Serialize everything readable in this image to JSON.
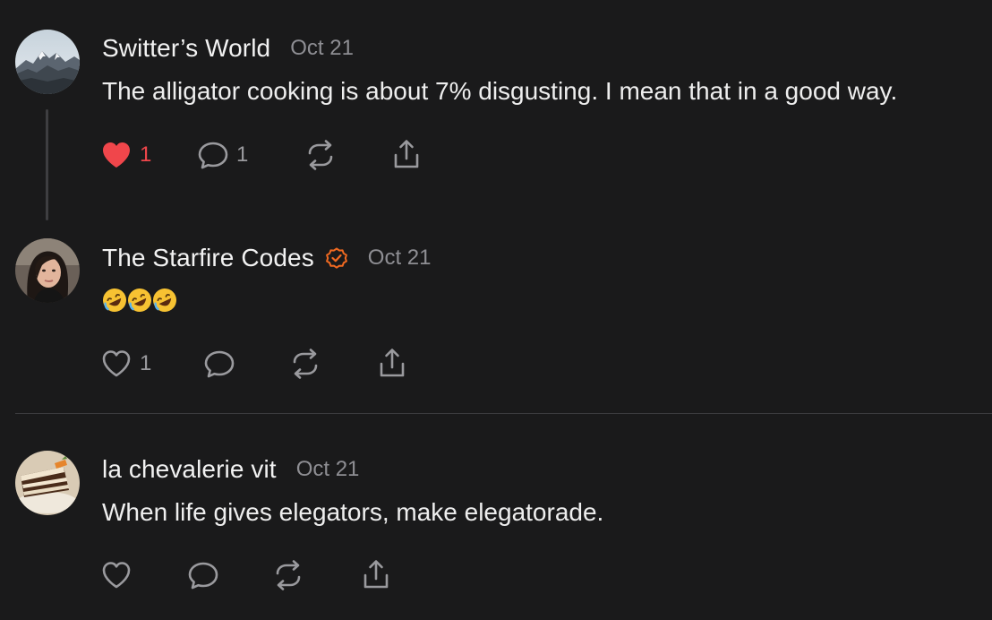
{
  "posts": [
    {
      "author": "Switter’s World",
      "date": "Oct 21",
      "text": "The alligator cooking is about 7% disgusting. I mean that in a good way.",
      "likes": "1",
      "liked": true,
      "comments": "1",
      "avatar": "mountain-landscape"
    },
    {
      "author": "The Starfire Codes",
      "verified": true,
      "date": "Oct 21",
      "emoji": "rolling-on-floor-laughing x3",
      "likes": "1",
      "liked": false,
      "comments": "",
      "avatar": "woman-portrait"
    },
    {
      "author": "la chevalerie vit",
      "date": "Oct 21",
      "text": "When life gives elegators, make elegatorade.",
      "likes": "",
      "liked": false,
      "comments": "",
      "avatar": "carrot-cake"
    }
  ],
  "colors": {
    "background": "#1a1a1b",
    "like_active": "#f0464b",
    "verified_badge": "#f26a21",
    "muted_text": "#8e8e93"
  },
  "icons": [
    "heart-icon",
    "comment-icon",
    "restack-icon",
    "share-icon",
    "verified-badge-icon"
  ]
}
